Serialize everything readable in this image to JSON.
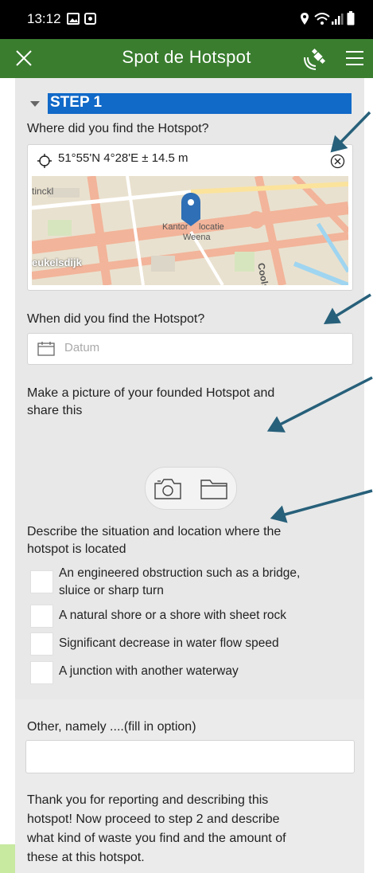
{
  "status_bar": {
    "time": "13:12"
  },
  "app_bar": {
    "title": "Spot de Hotspot"
  },
  "step": {
    "label": "STEP 1"
  },
  "location": {
    "question": "Where did you find the Hotspot?",
    "coordinates": "51°55'N 4°28'E ± 14.5 m",
    "map_labels": [
      "tinckl",
      "Kantor",
      "locatie",
      "Weena",
      "eukelsdijk",
      "Coolsi"
    ]
  },
  "date": {
    "question": "When did you find the Hotspot?",
    "placeholder": "Datum"
  },
  "picture": {
    "question_line1": "Make a picture of your founded Hotspot and",
    "question_line2": "share this"
  },
  "situation": {
    "question_line1": "Describe the situation and location where the",
    "question_line2": "hotspot is located",
    "options": [
      {
        "line1": "An engineered obstruction such as a bridge,",
        "line2": "sluice or sharp turn"
      },
      {
        "line1": "A natural shore or a shore with sheet rock",
        "line2": ""
      },
      {
        "line1": "Significant decrease in water flow speed",
        "line2": ""
      },
      {
        "line1": "A junction with another waterway",
        "line2": ""
      }
    ]
  },
  "other": {
    "label": "Other, namely ....(fill in option)",
    "value": ""
  },
  "thanks": {
    "line1": "Thank you for reporting and describing this",
    "line2": "hotspot! Now proceed to step 2 and describe",
    "line3": "what kind of waste you find and the amount of",
    "line4": "these at this hotspot."
  },
  "colors": {
    "app_bar": "#3a7d2f",
    "step_highlight": "#1169c8",
    "arrow": "#27607a"
  }
}
